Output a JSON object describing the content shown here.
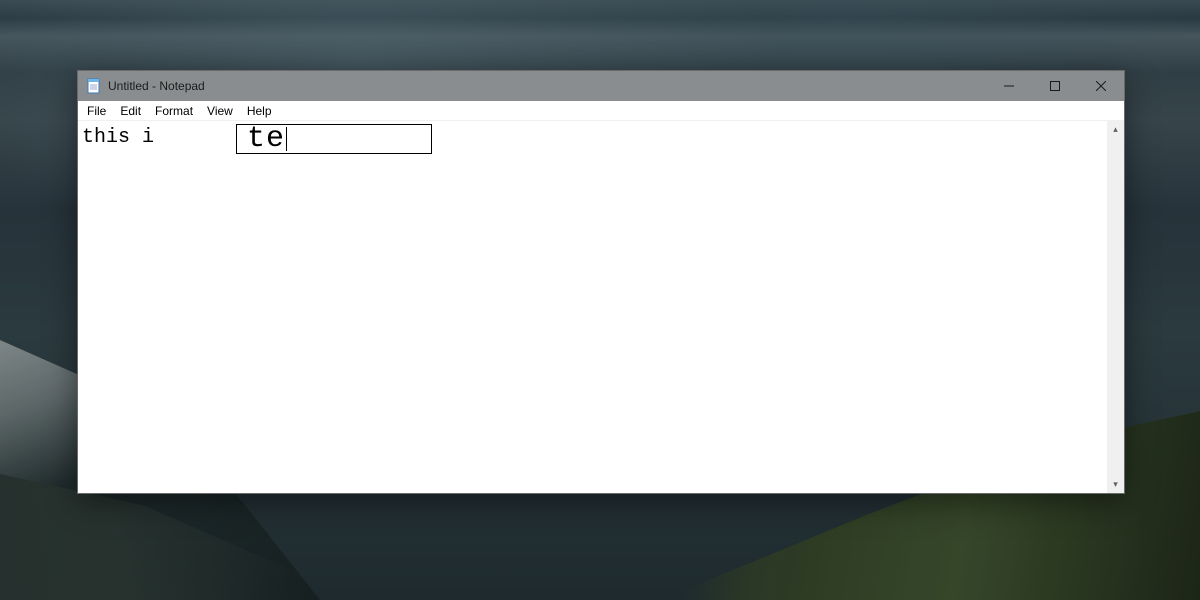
{
  "window": {
    "title": "Untitled - Notepad"
  },
  "menu": {
    "file": "File",
    "edit": "Edit",
    "format": "Format",
    "view": "View",
    "help": "Help"
  },
  "editor": {
    "text_line": "this i",
    "ime_composition": "te"
  }
}
